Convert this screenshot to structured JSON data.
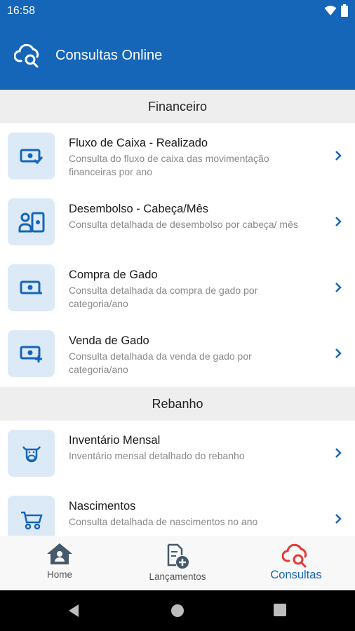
{
  "status_bar": {
    "time": "16:58"
  },
  "app_bar": {
    "title": "Consultas Online",
    "icon": "cloud-search-icon"
  },
  "sections": [
    {
      "title": "Financeiro",
      "items": [
        {
          "title": "Fluxo de Caixa - Realizado",
          "description": "Consulta do fluxo de caixa das movimentação financeiras por ano",
          "icon": "cash-check-icon"
        },
        {
          "title": "Desembolso - Cabeça/Mês",
          "description": "Consulta detalhada de desembolso por cabeça/ mês",
          "icon": "person-cash-icon"
        },
        {
          "title": "Compra de Gado",
          "description": "Consulta detalhada da compra de gado por categoria/ano",
          "icon": "cash-minus-icon"
        },
        {
          "title": "Venda de Gado",
          "description": "Consulta detalhada da venda de gado por categoria/ano",
          "icon": "cash-plus-icon"
        }
      ]
    },
    {
      "title": "Rebanho",
      "items": [
        {
          "title": "Inventário Mensal",
          "description": "Inventário mensal detalhado do rebanho",
          "icon": "cow-icon"
        },
        {
          "title": "Nascimentos",
          "description": "Consulta detalhada de nascimentos no ano",
          "icon": "stroller-icon"
        }
      ]
    }
  ],
  "bottom_nav": [
    {
      "label": "Home",
      "icon": "home-icon",
      "active": false
    },
    {
      "label": "Lançamentos",
      "icon": "document-add-icon",
      "active": false
    },
    {
      "label": "Consultas",
      "icon": "cloud-search-icon",
      "active": true
    }
  ],
  "colors": {
    "primary": "#1565b8",
    "icon_bg": "#dceaf7",
    "active_icon": "#e53935",
    "section_bg": "#eeeeee"
  }
}
